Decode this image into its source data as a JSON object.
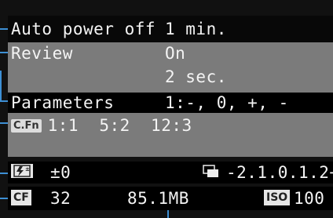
{
  "settings": {
    "auto_power_off": {
      "label": "Auto power off",
      "value": "1 min."
    },
    "review": {
      "label": "Review",
      "value": "On",
      "value2": "2 sec."
    },
    "parameters": {
      "label": "Parameters",
      "value": "1:-, 0, +, -"
    },
    "custom_functions": {
      "icon_text": "C.Fn",
      "value": "1:1  5:2  12:3"
    }
  },
  "status": {
    "flash_exposure_comp": {
      "icon": "flash-exposure-compensation-icon",
      "value": "±0"
    },
    "exposure_bracket": {
      "icon": "bracketing-icon",
      "scale": "-2.1.0.1.2+"
    },
    "card": {
      "icon_text": "CF",
      "shots_remaining": "32",
      "free_space": "85.1MB"
    },
    "iso": {
      "icon_text": "ISO",
      "value": "100"
    }
  },
  "colors": {
    "highlight_bg": "#7b7b7b",
    "annotation_lines": "#3d8fd4"
  }
}
